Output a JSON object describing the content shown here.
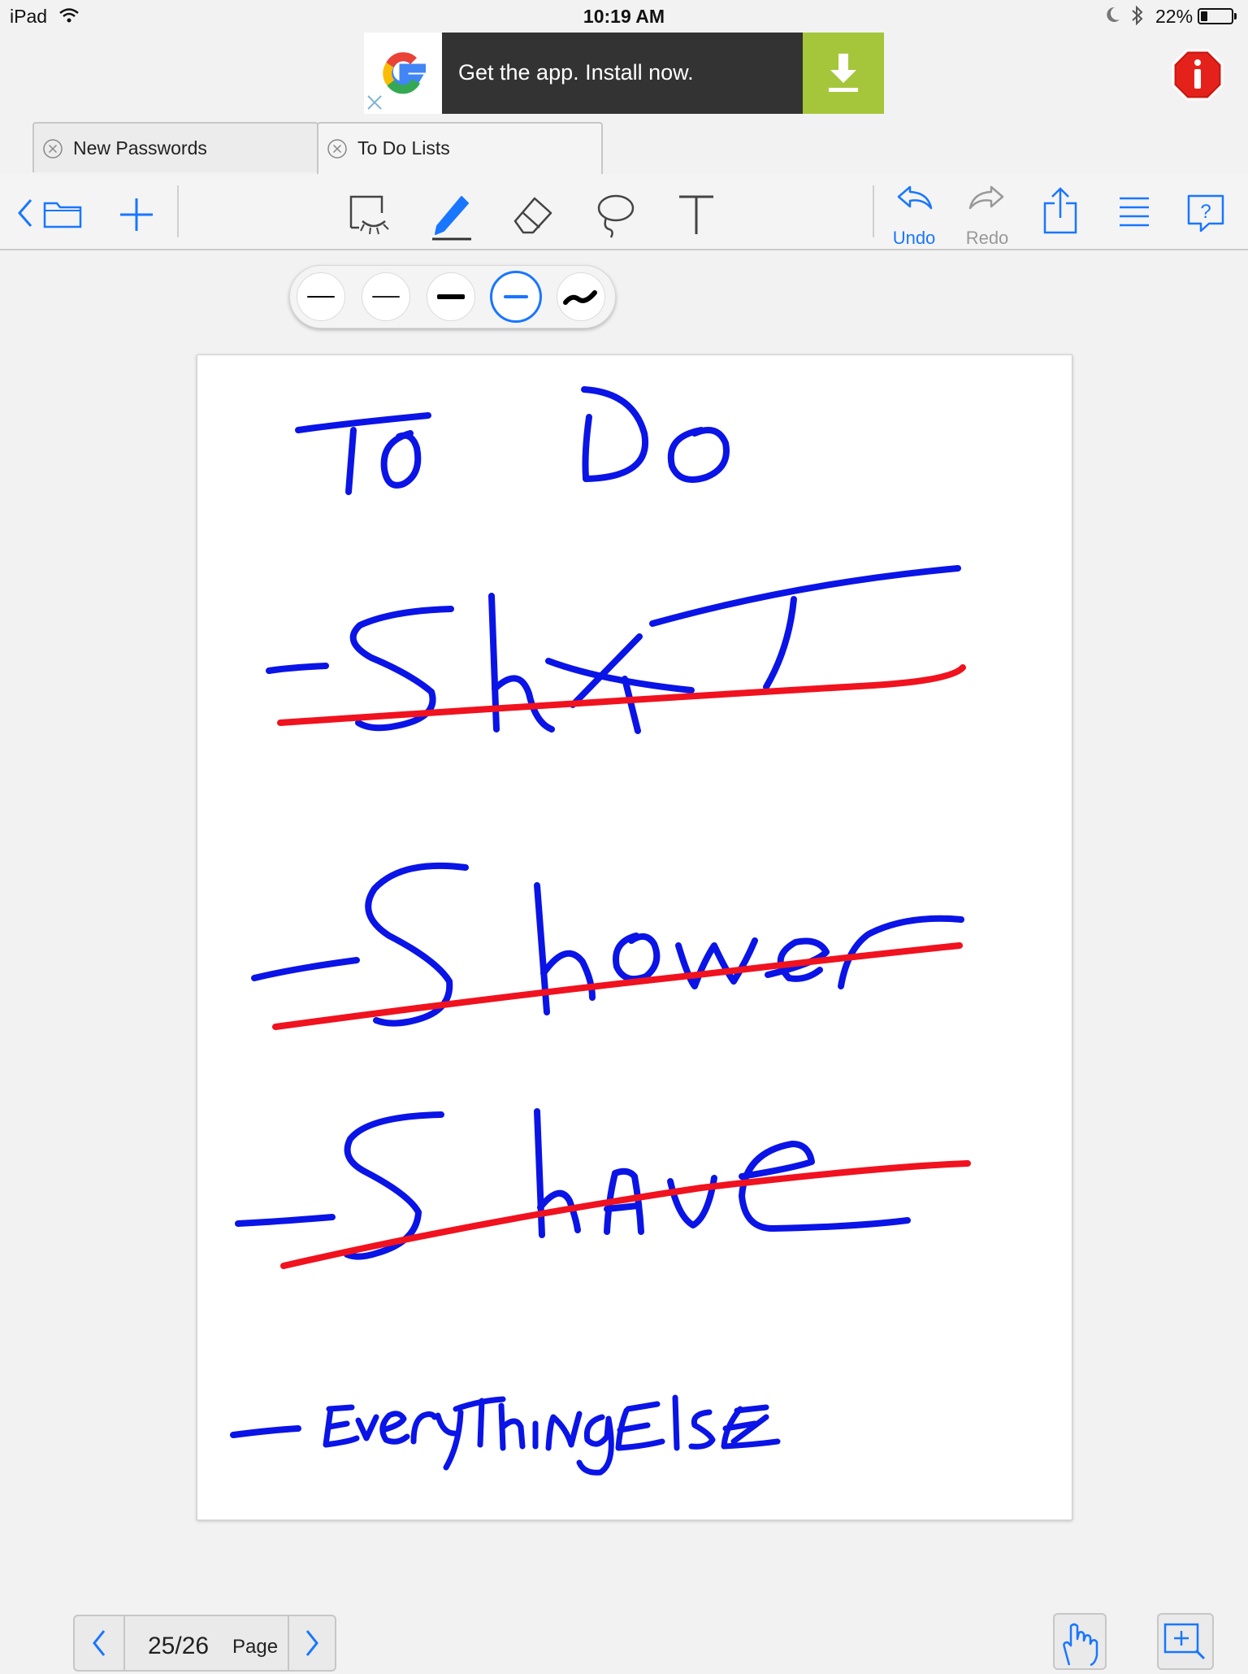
{
  "status_bar": {
    "carrier": "iPad",
    "time": "10:19 AM",
    "battery_percent": "22%",
    "battery_level": 0.22,
    "icons": [
      "wifi-icon",
      "moon-icon",
      "bluetooth-icon",
      "battery-icon"
    ]
  },
  "ad": {
    "text": "Get the app. Install now.",
    "icons": [
      "google-logo",
      "download-icon",
      "ad-close-icon"
    ],
    "colors": {
      "background": "#333333",
      "download_bg": "#a5c63b"
    }
  },
  "tabs": [
    {
      "label": "New Passwords",
      "active": false
    },
    {
      "label": "To Do Lists",
      "active": true
    }
  ],
  "toolbar": {
    "undo_label": "Undo",
    "redo_label": "Redo",
    "left_icons": [
      "back-chevron-icon",
      "folder-icon",
      "add-icon"
    ],
    "tool_icons": [
      "select-tool-icon",
      "pen-tool-icon",
      "eraser-tool-icon",
      "lasso-tool-icon",
      "text-tool-icon"
    ],
    "right_icons": [
      "undo-icon",
      "redo-icon",
      "share-icon",
      "menu-icon",
      "help-icon"
    ],
    "accent_color": "#1976ff"
  },
  "pen_palette": {
    "options": [
      "thin-black",
      "medium-black",
      "thick-black",
      "blue-selected",
      "calligraphy"
    ],
    "selected_index": 3
  },
  "page_nav": {
    "current_page": "25/26",
    "page_word": "Page"
  },
  "ink": {
    "blue": "#0a14e6",
    "red": "#f0121e"
  }
}
